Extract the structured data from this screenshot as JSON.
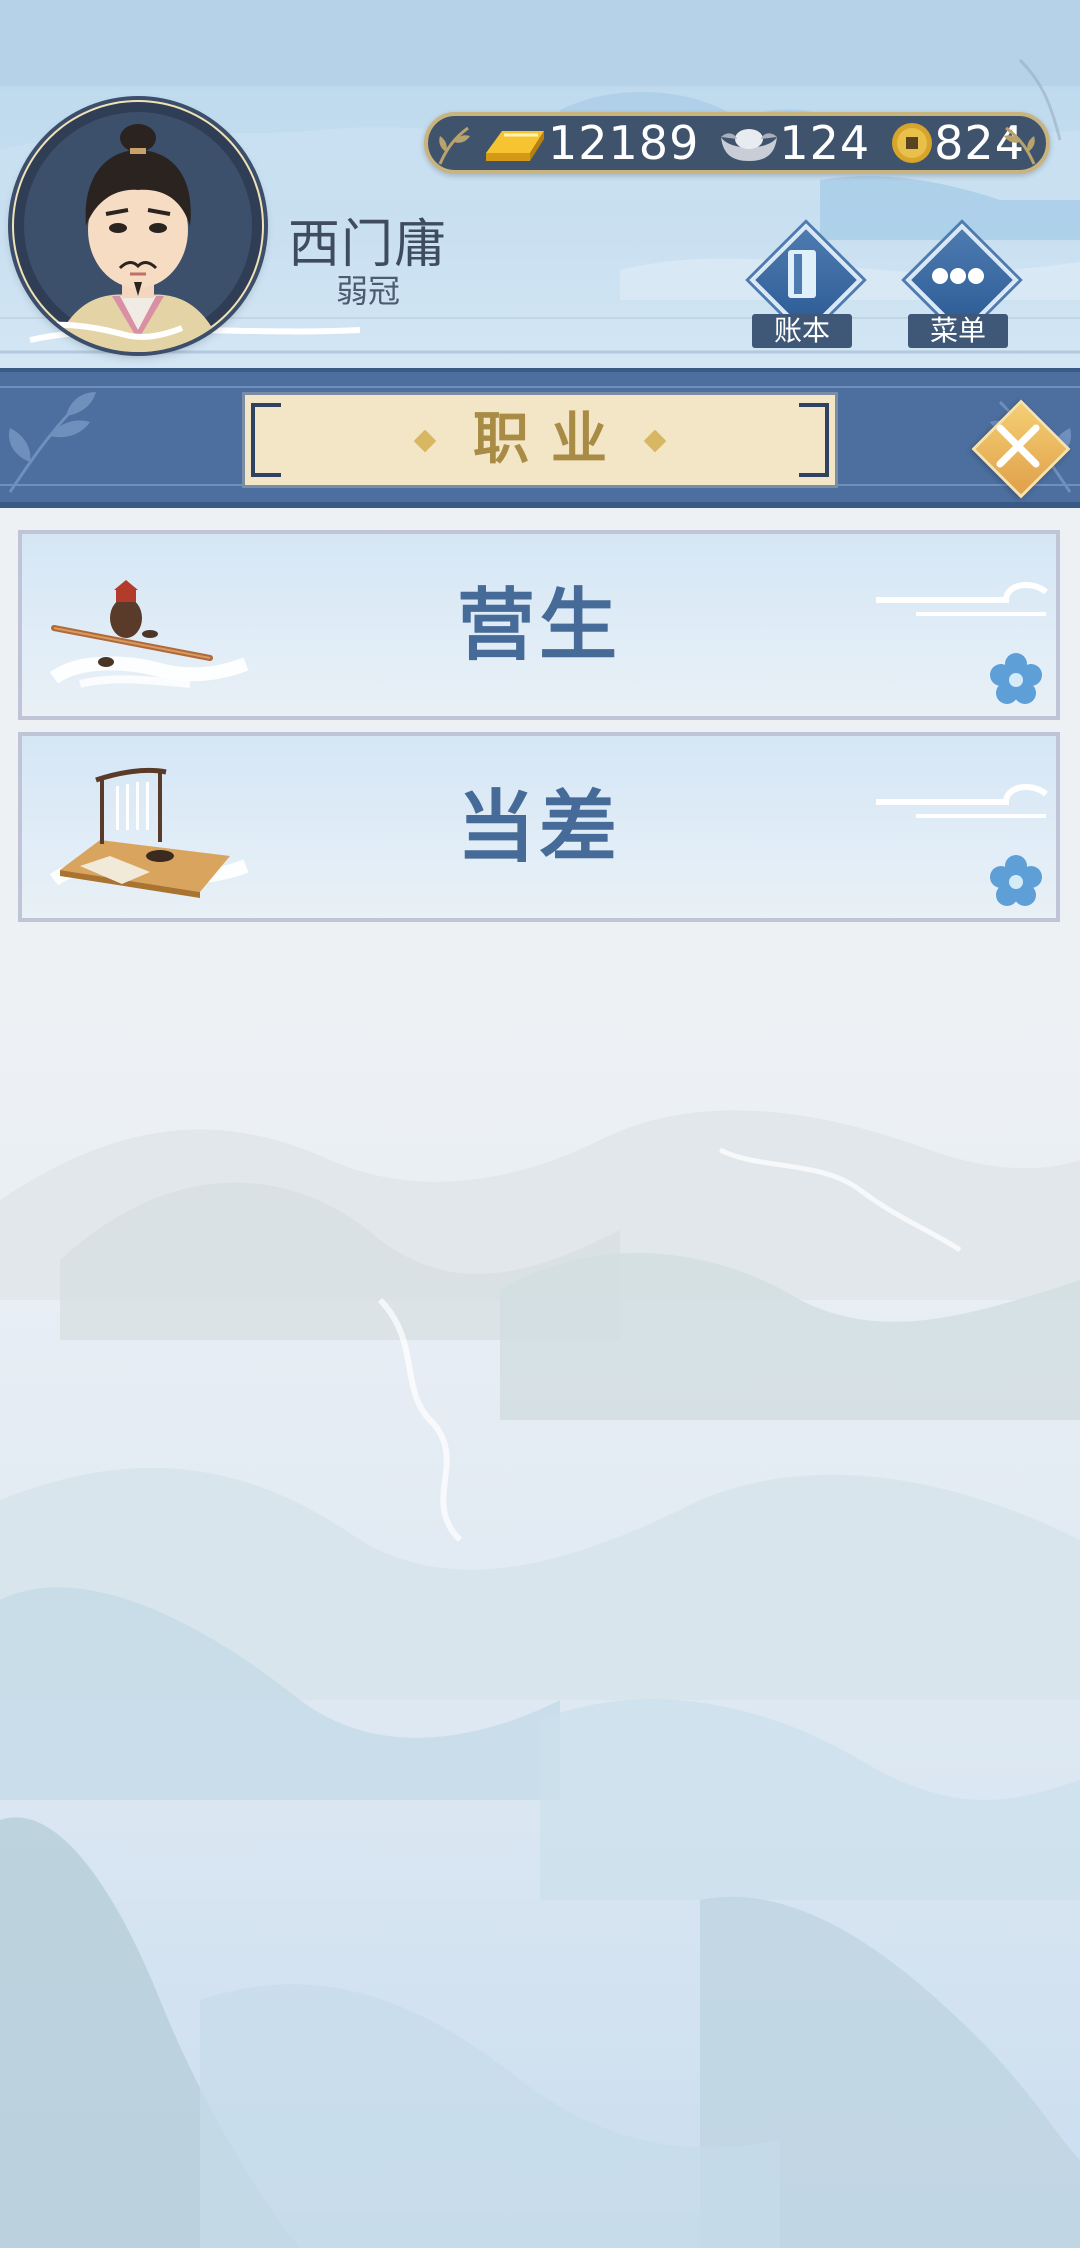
{
  "player": {
    "name": "西门庸",
    "title": "弱冠"
  },
  "currency": {
    "gold": "12189",
    "silver": "124",
    "coin": "824"
  },
  "header_buttons": {
    "ledger_label": "账本",
    "menu_label": "菜单"
  },
  "page": {
    "title": "职业"
  },
  "jobs": [
    {
      "label": "营生",
      "icon": "pipe-and-jar-icon"
    },
    {
      "label": "当差",
      "icon": "desk-and-brush-rack-icon"
    }
  ],
  "colors": {
    "strip": "#4d6f9f",
    "plaque": "#f3e6c7",
    "plaque_text": "#a88c45",
    "card_text": "#476b98",
    "close_button": "#e8b25a"
  }
}
